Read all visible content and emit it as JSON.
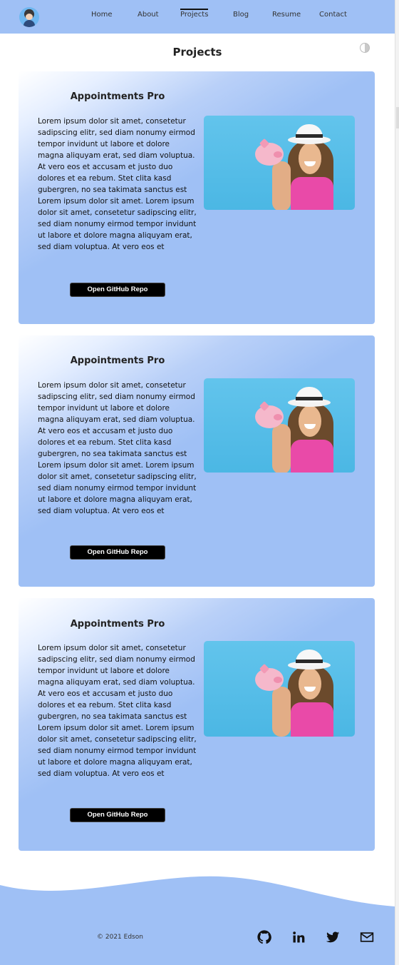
{
  "nav": {
    "items": [
      {
        "label": "Home"
      },
      {
        "label": "About"
      },
      {
        "label": "Projects"
      },
      {
        "label": "Blog"
      },
      {
        "label": "Resume"
      },
      {
        "label": "Contact"
      }
    ],
    "active": "Projects"
  },
  "page": {
    "title": "Projects"
  },
  "projects": [
    {
      "title": "Appointments Pro",
      "description": "Lorem ipsum dolor sit amet, consetetur sadipscing elitr, sed diam nonumy eirmod tempor invidunt ut labore et dolore magna aliquyam erat, sed diam voluptua. At vero eos et accusam et justo duo dolores et ea rebum. Stet clita kasd gubergren, no sea takimata sanctus est Lorem ipsum dolor sit amet. Lorem ipsum dolor sit amet, consetetur sadipscing elitr, sed diam nonumy eirmod tempor invidunt ut labore et dolore magna aliquyam erat, sed diam voluptua. At vero eos et",
      "button_label": "Open GitHub Repo"
    },
    {
      "title": "Appointments Pro",
      "description": "Lorem ipsum dolor sit amet, consetetur sadipscing elitr, sed diam nonumy eirmod tempor invidunt ut labore et dolore magna aliquyam erat, sed diam voluptua. At vero eos et accusam et justo duo dolores et ea rebum. Stet clita kasd gubergren, no sea takimata sanctus est Lorem ipsum dolor sit amet. Lorem ipsum dolor sit amet, consetetur sadipscing elitr, sed diam nonumy eirmod tempor invidunt ut labore et dolore magna aliquyam erat, sed diam voluptua. At vero eos et",
      "button_label": "Open GitHub Repo"
    },
    {
      "title": "Appointments Pro",
      "description": "Lorem ipsum dolor sit amet, consetetur sadipscing elitr, sed diam nonumy eirmod tempor invidunt ut labore et dolore magna aliquyam erat, sed diam voluptua. At vero eos et accusam et justo duo dolores et ea rebum. Stet clita kasd gubergren, no sea takimata sanctus est Lorem ipsum dolor sit amet. Lorem ipsum dolor sit amet, consetetur sadipscing elitr, sed diam nonumy eirmod tempor invidunt ut labore et dolore magna aliquyam erat, sed diam voluptua. At vero eos et",
      "button_label": "Open GitHub Repo"
    }
  ],
  "footer": {
    "copyright": "© 2021 Edson",
    "social_icons": [
      "github-icon",
      "linkedin-icon",
      "twitter-icon",
      "mail-icon"
    ]
  },
  "colors": {
    "accent": "#9fc0f5",
    "button": "#000000"
  }
}
